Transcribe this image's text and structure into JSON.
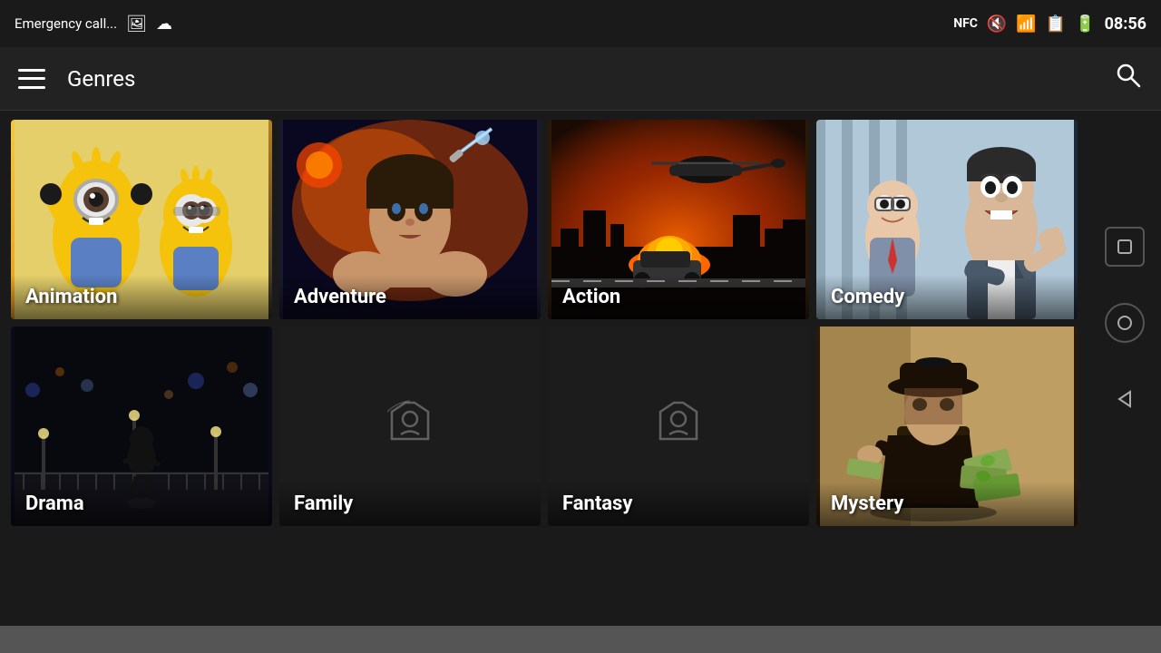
{
  "statusBar": {
    "emergencyCall": "Emergency call...",
    "time": "08:56",
    "nfc": "NFC",
    "icons": [
      "gallery-icon",
      "cloud-icon",
      "nfc-icon",
      "mute-icon",
      "wifi-icon",
      "sim-icon",
      "battery-icon"
    ]
  },
  "appBar": {
    "title": "Genres",
    "menuIcon": "hamburger-icon",
    "searchIcon": "search-icon"
  },
  "genres": [
    {
      "id": "animation",
      "label": "Animation",
      "hasBg": true,
      "bgType": "animation"
    },
    {
      "id": "adventure",
      "label": "Adventure",
      "hasBg": true,
      "bgType": "adventure"
    },
    {
      "id": "action",
      "label": "Action",
      "hasBg": true,
      "bgType": "action"
    },
    {
      "id": "comedy",
      "label": "Comedy",
      "hasBg": true,
      "bgType": "comedy"
    },
    {
      "id": "drama",
      "label": "Drama",
      "hasBg": true,
      "bgType": "drama"
    },
    {
      "id": "family",
      "label": "Family",
      "hasBg": false,
      "bgType": "placeholder"
    },
    {
      "id": "fantasy",
      "label": "Fantasy",
      "hasBg": false,
      "bgType": "placeholder"
    },
    {
      "id": "mystery",
      "label": "Mystery",
      "hasBg": true,
      "bgType": "mystery"
    }
  ],
  "navButtons": {
    "square": "□",
    "circle": "○",
    "triangle": "◁"
  },
  "colors": {
    "bg": "#1a1a1a",
    "appBar": "#222222",
    "tileOverlay": "rgba(0,0,0,0.5)"
  }
}
